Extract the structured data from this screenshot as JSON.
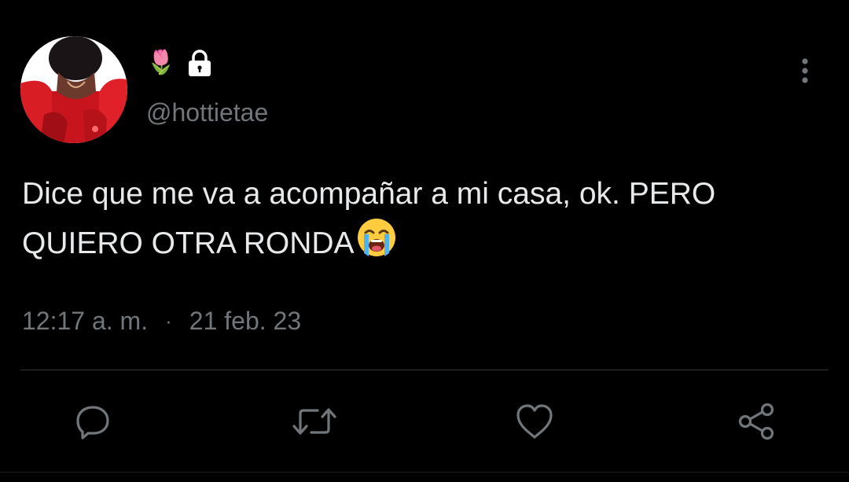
{
  "colors": {
    "background": "#000000",
    "text": "#e7e9ea",
    "secondary": "#71767b",
    "divider": "#2f3336"
  },
  "author": {
    "display_name_emoji": "🌷",
    "handle": "@hottietae",
    "protected_icon": "lock-icon",
    "avatar_icon": "avatar"
  },
  "tweet": {
    "text": "Dice que me va a acompañar a mi casa, ok. PERO QUIERO OTRA RONDA",
    "trailing_emoji": "loudly-crying-face-emoji"
  },
  "meta": {
    "time": "12:17 a. m.",
    "separator": "·",
    "date": "21 feb. 23"
  },
  "actions": [
    {
      "icon": "reply-icon"
    },
    {
      "icon": "retweet-icon"
    },
    {
      "icon": "like-icon"
    },
    {
      "icon": "share-icon"
    }
  ],
  "menu": {
    "icon": "more-vertical-icon"
  }
}
